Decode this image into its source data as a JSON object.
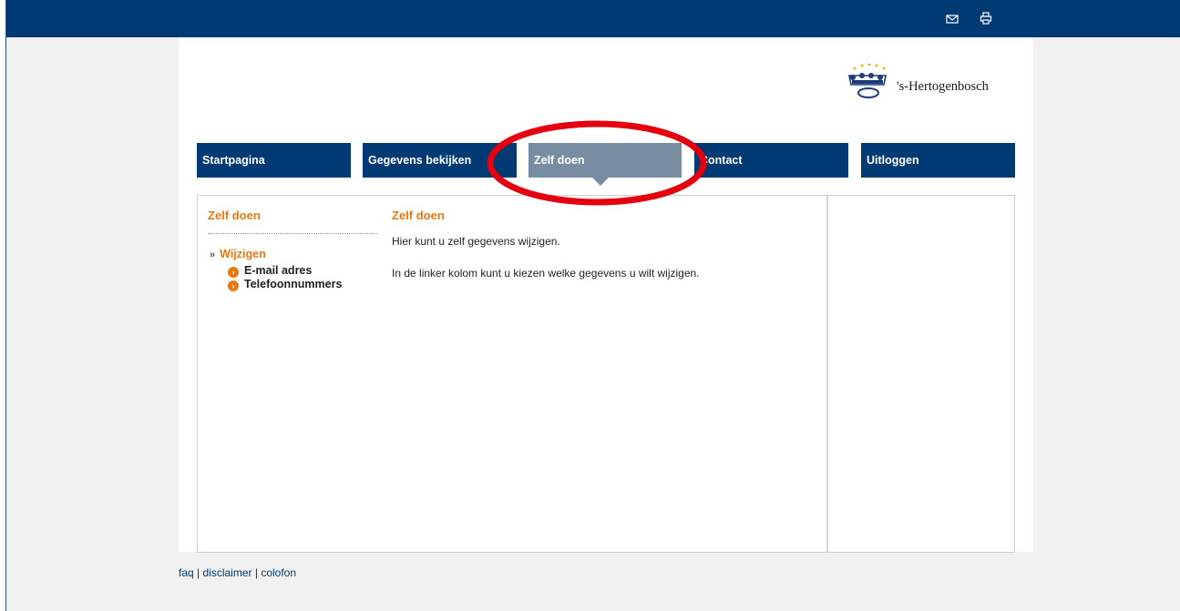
{
  "topbar": {
    "icons": [
      "mail-icon",
      "print-icon"
    ],
    "color": "#003a74"
  },
  "logo": {
    "text": "'s-Hertogenbosch",
    "emblem": "crown-icon"
  },
  "nav": {
    "items": [
      {
        "label": "Startpagina"
      },
      {
        "label": "Gegevens bekijken"
      },
      {
        "label": "Zelf doen"
      },
      {
        "label": "Contact"
      },
      {
        "label": "Uitloggen"
      }
    ],
    "active_index": 2
  },
  "sidebar": {
    "title": "Zelf doen",
    "group": {
      "label": "Wijzigen",
      "items": [
        {
          "label": "E-mail adres"
        },
        {
          "label": "Telefoonnummers"
        }
      ]
    }
  },
  "main": {
    "title": "Zelf doen",
    "paragraphs": [
      "Hier kunt u zelf gegevens wijzigen.",
      "In de linker kolom kunt u kiezen welke gegevens u wilt wijzigen."
    ]
  },
  "footer": {
    "links": [
      "faq",
      "disclaimer",
      "colofon"
    ],
    "separator": "|"
  },
  "colors": {
    "brand": "#003a74",
    "accent": "#e8780e",
    "active_tab": "#798da2",
    "annotation": "#e3000f"
  }
}
